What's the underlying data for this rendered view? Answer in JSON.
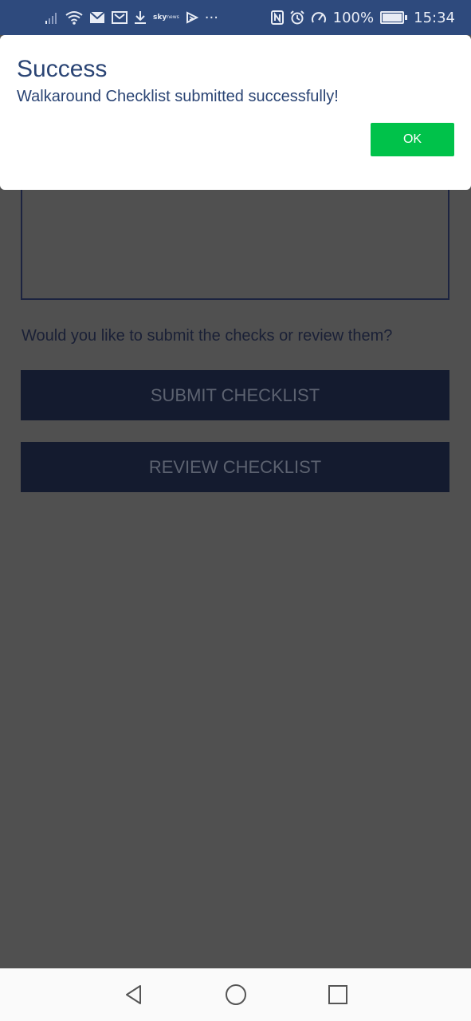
{
  "status_bar": {
    "battery": "100%",
    "time": "15:34",
    "icons": [
      "signal-icon",
      "wifi-icon",
      "mail-icon",
      "gallery-mail-icon",
      "download-icon",
      "sky-news-icon",
      "play-icon",
      "more-icon",
      "nfc-icon",
      "alarm-icon",
      "speed-icon",
      "battery-icon"
    ],
    "sky_label": "sky",
    "sky_sub": "news",
    "more": "···",
    "battery_level": 1.0
  },
  "page": {
    "prompt": "Would you like to submit the checks or review them?",
    "submit_label": "SUBMIT CHECKLIST",
    "review_label": "REVIEW CHECKLIST"
  },
  "dialog": {
    "title": "Success",
    "message": "Walkaround Checklist submitted successfully!",
    "ok_label": "OK"
  },
  "nav_bar": {
    "icons": [
      "back-icon",
      "home-icon",
      "recents-icon"
    ]
  },
  "colors": {
    "status_bar": "#2e4a7d",
    "dialog_text": "#2a4474",
    "ok_button": "#00c24a",
    "action_button": "#141b2f",
    "overlay": "#505050"
  }
}
